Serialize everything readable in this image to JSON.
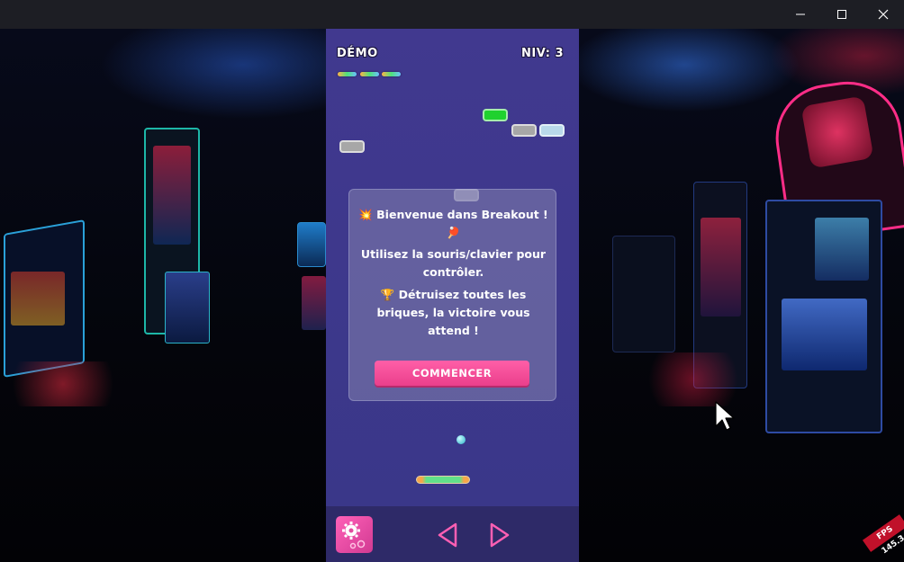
{
  "hud": {
    "mode": "DÉMO",
    "level": "NIV: 3"
  },
  "lives": 3,
  "welcome": {
    "line1": "💥 Bienvenue dans Breakout ! 🏓",
    "line2": "Utilisez la souris/clavier pour contrôler.",
    "line3": "🏆 Détruisez toutes les briques, la victoire vous attend !"
  },
  "start_button": "COMMENCER",
  "fps": "FPS 145.3",
  "colors": {
    "panel": "#3f3a8c",
    "button": "#ea3f8c",
    "brick_green": "#1fd12e",
    "brick_gray": "#a7a7a7",
    "brick_light_blue": "#b9d9ea"
  },
  "icons": [
    "close-icon",
    "maximize-icon",
    "minimize-icon",
    "gear-icon",
    "left-arrow-icon",
    "right-arrow-icon",
    "pointer-cursor-icon"
  ]
}
